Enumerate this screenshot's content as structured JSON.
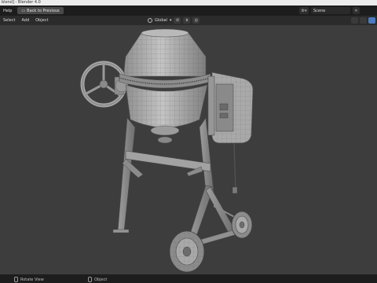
{
  "window": {
    "title": "blend] - Blender 4.0"
  },
  "topbar": {
    "menu": [
      "Help"
    ],
    "back_button": "Back to Previous",
    "scene": {
      "name": "Scene"
    }
  },
  "header": {
    "menu": [
      "Select",
      "Add",
      "Object"
    ],
    "orientation": "Global"
  },
  "status": {
    "left": "Rotate View",
    "right": "Object"
  },
  "colors": {
    "chrome_dark": "#1d1d1d",
    "header": "#2b2b2b",
    "viewport_bg": "#3d3d3d",
    "accent": "#4b7bbd"
  },
  "icons": [
    "gear-icon",
    "globe-icon",
    "snap-icon",
    "proportional-icon",
    "scene-icon",
    "mouse-icon",
    "close-icon"
  ]
}
